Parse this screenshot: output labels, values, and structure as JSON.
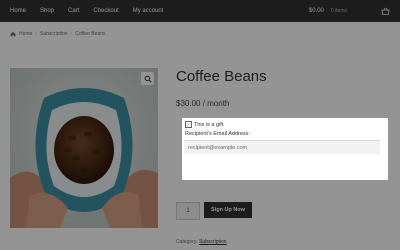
{
  "nav": {
    "items": [
      "Home",
      "Shop",
      "Cart",
      "Checkout",
      "My account"
    ],
    "cart_total": "$0.00",
    "cart_count": "0 items"
  },
  "breadcrumb": {
    "home": "Home",
    "subscription": "Subscription",
    "current": "Coffee Beans"
  },
  "product": {
    "title": "Coffee Beans",
    "price": "$30.00 / month",
    "quantity": "1",
    "signup_label": "Sign Up Now",
    "category_label": "Category:",
    "category_value": "Subscription"
  },
  "gift": {
    "checkbox_label": "This is a gift",
    "email_label": "Recipient's Email Address:",
    "email_placeholder": "recipient@example.com",
    "checked": true
  },
  "colors": {
    "topbar": "#333333",
    "overlay": "rgba(0,0,0,0.42)",
    "button": "#333333"
  }
}
